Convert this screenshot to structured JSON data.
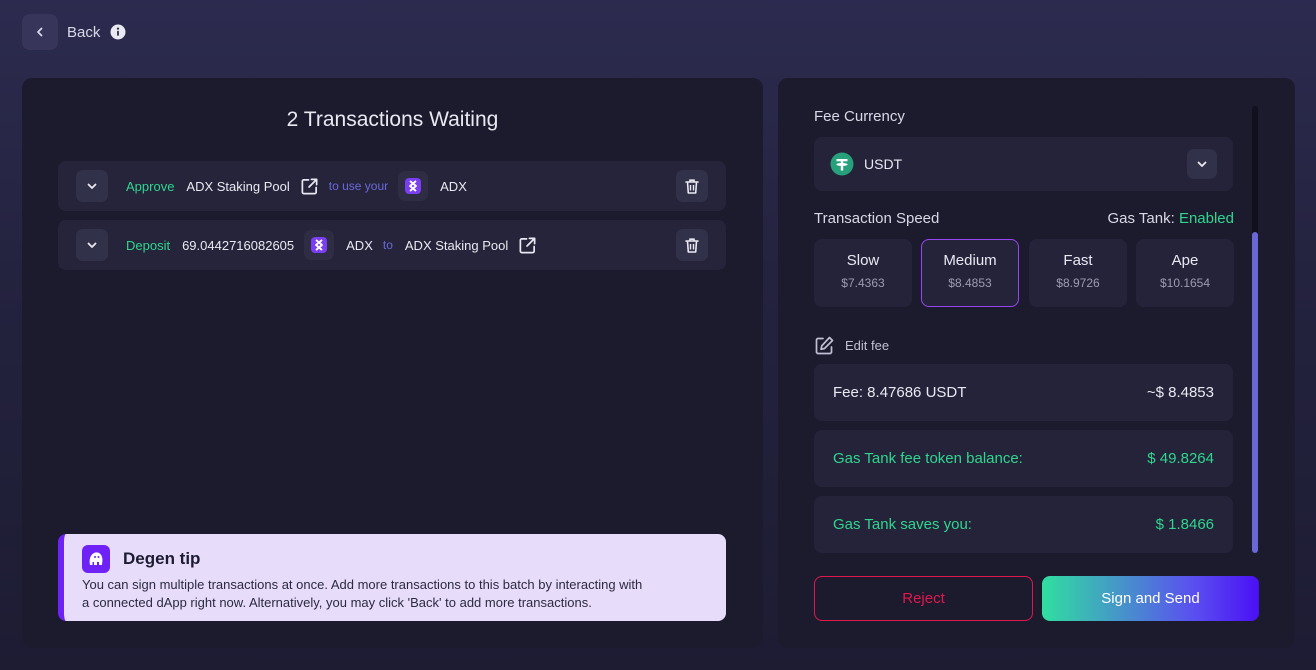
{
  "header": {
    "back_label": "Back"
  },
  "left": {
    "title": "2 Transactions Waiting",
    "transactions": [
      {
        "action": "Approve",
        "target": "ADX Staking Pool",
        "connector": "to use your",
        "token": "ADX"
      },
      {
        "action": "Deposit",
        "amount": "69.0442716082605",
        "token": "ADX",
        "connector": "to",
        "target": "ADX Staking Pool"
      }
    ],
    "tip": {
      "title": "Degen tip",
      "line1": "You can sign multiple transactions at once. Add more transactions to this batch by interacting with",
      "line2": "a connected dApp right now. Alternatively, you may click 'Back' to add more transactions."
    }
  },
  "right": {
    "fee_currency_label": "Fee Currency",
    "fee_currency_value": "USDT",
    "speed_label": "Transaction Speed",
    "gas_tank_label": "Gas Tank:",
    "gas_tank_status": "Enabled",
    "speeds": [
      {
        "name": "Slow",
        "value": "$7.4363"
      },
      {
        "name": "Medium",
        "value": "$8.4853",
        "selected": true
      },
      {
        "name": "Fast",
        "value": "$8.9726"
      },
      {
        "name": "Ape",
        "value": "$10.1654"
      }
    ],
    "edit_fee_label": "Edit fee",
    "fee": {
      "label": "Fee: 8.47686 USDT",
      "value": "~$ 8.4853"
    },
    "gas_balance": {
      "label": "Gas Tank fee token balance:",
      "value": "$ 49.8264"
    },
    "gas_saves": {
      "label": "Gas Tank saves you:",
      "value": "$ 1.8466"
    },
    "reject_label": "Reject",
    "sign_label": "Sign and Send"
  },
  "colors": {
    "accent_green": "#2fd68e",
    "accent_purple": "#6f22f5",
    "reject_red": "#e0174f",
    "usdt_green": "#26a17b"
  }
}
